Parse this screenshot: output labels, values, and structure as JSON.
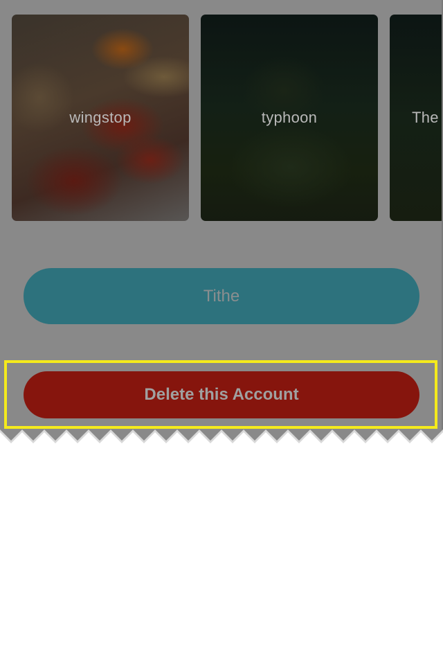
{
  "cards": [
    {
      "label": "wingstop"
    },
    {
      "label": "typhoon"
    },
    {
      "label": "The"
    }
  ],
  "buttons": {
    "tithe_label": "Tithe",
    "delete_label": "Delete this Account"
  },
  "colors": {
    "tithe": "#2d727d",
    "delete": "#86150d",
    "highlight": "#f5ea1c",
    "overlay": "#898989"
  }
}
